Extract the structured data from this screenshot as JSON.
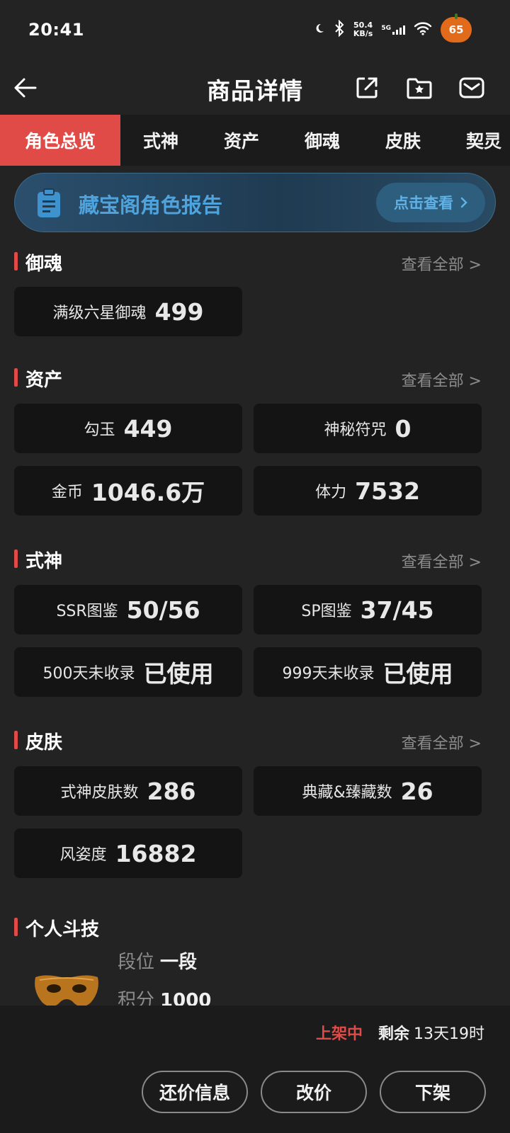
{
  "status_bar": {
    "time": "20:41",
    "net_speed_value": "50.4",
    "net_speed_unit": "KB/s",
    "network": "5G",
    "battery": "65"
  },
  "header": {
    "title": "商品详情"
  },
  "tabs": [
    {
      "label": "角色总览",
      "active": true
    },
    {
      "label": "式神",
      "active": false
    },
    {
      "label": "资产",
      "active": false
    },
    {
      "label": "御魂",
      "active": false
    },
    {
      "label": "皮肤",
      "active": false
    },
    {
      "label": "契灵",
      "active": false
    }
  ],
  "banner": {
    "text": "藏宝阁角色报告",
    "button": "点击查看"
  },
  "sections": {
    "yuhun": {
      "title": "御魂",
      "more": "查看全部 >",
      "cards": [
        {
          "label": "满级六星御魂",
          "value": "499"
        }
      ]
    },
    "assets": {
      "title": "资产",
      "more": "查看全部 >",
      "cards": [
        {
          "label": "勾玉",
          "value": "449"
        },
        {
          "label": "神秘符咒",
          "value": "0"
        },
        {
          "label": "金币",
          "value": "1046.6万"
        },
        {
          "label": "体力",
          "value": "7532"
        }
      ]
    },
    "shikigami": {
      "title": "式神",
      "more": "查看全部 >",
      "cards": [
        {
          "label": "SSR图鉴",
          "value": "50/56"
        },
        {
          "label": "SP图鉴",
          "value": "37/45"
        },
        {
          "label": "500天未收录",
          "value": "已使用"
        },
        {
          "label": "999天未收录",
          "value": "已使用"
        }
      ]
    },
    "skins": {
      "title": "皮肤",
      "more": "查看全部 >",
      "cards": [
        {
          "label": "式神皮肤数",
          "value": "286"
        },
        {
          "label": "典藏&臻藏数",
          "value": "26"
        },
        {
          "label": "风姿度",
          "value": "16882"
        }
      ]
    },
    "arena": {
      "title": "个人斗技",
      "rank_label": "段位",
      "rank_value": "一段",
      "score_label": "积分",
      "score_value": "1000"
    }
  },
  "bottom": {
    "status": "上架中",
    "remaining_label": "剩余",
    "remaining_value": "13天19时",
    "buttons": {
      "counter_offer": "还价信息",
      "change_price": "改价",
      "delist": "下架"
    }
  },
  "colors": {
    "accent": "#e04b48",
    "background": "#232323",
    "card": "#141414",
    "banner_text": "#4fa3dd"
  }
}
